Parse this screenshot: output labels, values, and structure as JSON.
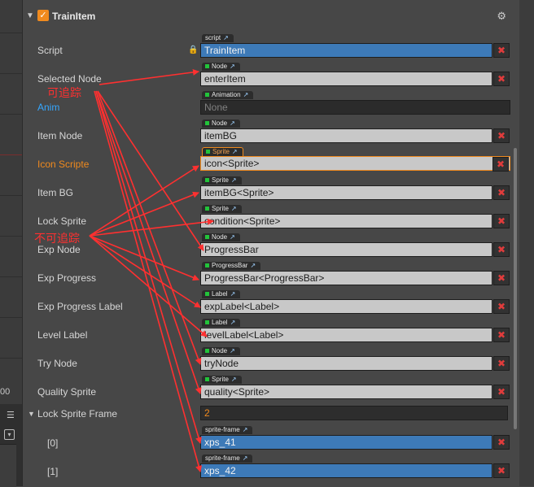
{
  "sidebar": {
    "partial_number": "00",
    "menu_glyph": "☰",
    "dropdown_glyph": "▾"
  },
  "component": {
    "title": "TrainItem",
    "enabled": true,
    "check_glyph": "✓",
    "collapse_glyph": "▼",
    "gear_glyph": "⚙",
    "lock_glyph": "🔒"
  },
  "labels": {
    "script": "Script",
    "selected_node": "Selected Node",
    "anim": "Anim",
    "item_node": "Item Node",
    "icon_scripte": "Icon Scripte",
    "item_bg": "Item BG",
    "lock_sprite": "Lock Sprite",
    "exp_node": "Exp Node",
    "exp_progress": "Exp Progress",
    "exp_progress_label": "Exp Progress Label",
    "level_label": "Level Label",
    "try_node": "Try Node",
    "quality_sprite": "Quality Sprite",
    "lock_sprite_frame": "Lock Sprite Frame",
    "frame_0": "[0]",
    "frame_1": "[1]"
  },
  "tags": {
    "script": "script",
    "node": "Node",
    "animation": "Animation",
    "sprite": "Sprite",
    "progressbar": "ProgressBar",
    "label": "Label",
    "sprite_frame": "sprite-frame",
    "ext_glyph": "↗"
  },
  "values": {
    "script": "TrainItem",
    "selected_node": "enterItem",
    "anim": "None",
    "item_node": "itemBG",
    "icon_scripte": "icon<Sprite>",
    "item_bg": "itemBG<Sprite>",
    "lock_sprite": "condition<Sprite>",
    "exp_node": "ProgressBar",
    "exp_progress": "ProgressBar<ProgressBar>",
    "exp_progress_label": "expLabel<Label>",
    "level_label": "levelLabel<Label>",
    "try_node": "tryNode",
    "quality_sprite": "quality<Sprite>",
    "lock_sprite_frame_count": "2",
    "frame_0": "xps_41",
    "frame_1": "xps_42"
  },
  "clear_glyph": "✖",
  "annotations": {
    "traceable": "可追踪",
    "untraceable": "不可追踪"
  },
  "colors": {
    "annotation_red": "#ff3030",
    "accent_orange": "#f08a1e",
    "anim_blue": "#35a7ff",
    "object_blue": "#3d7ab8",
    "clear_red": "#e03c3c"
  }
}
